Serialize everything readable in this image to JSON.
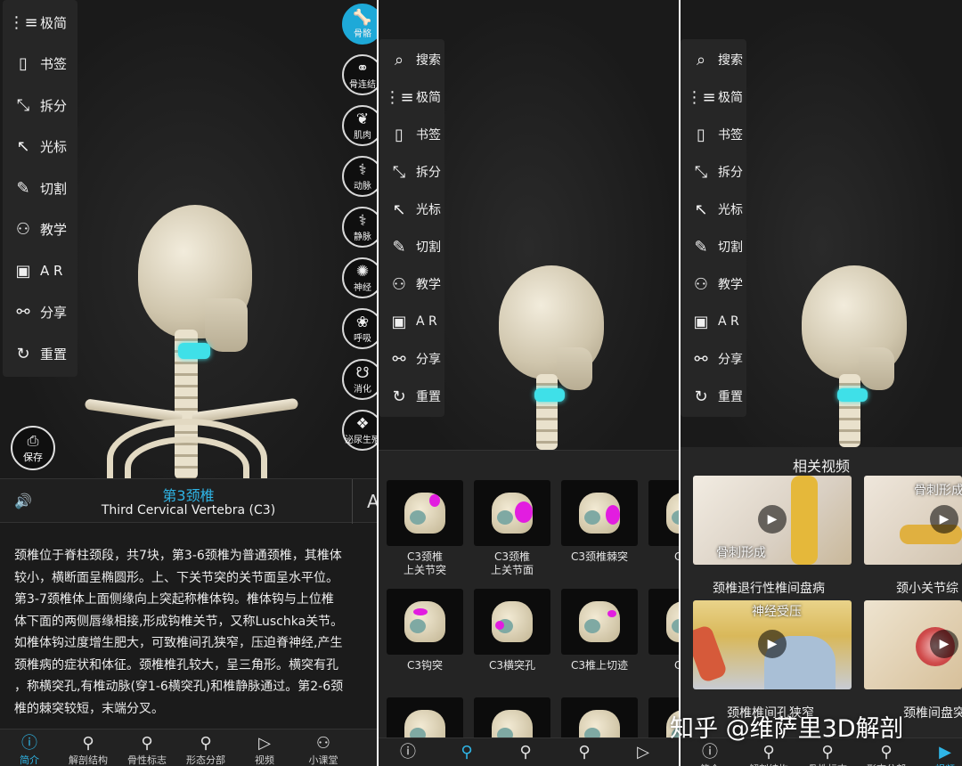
{
  "panel1": {
    "toolbar": [
      {
        "icon": "collapse-icon",
        "glyph": "⋮≡",
        "label": "极简"
      },
      {
        "icon": "bookmark-icon",
        "glyph": "▯",
        "label": "书签"
      },
      {
        "icon": "split-icon",
        "glyph": "⤡",
        "label": "拆分"
      },
      {
        "icon": "cursor-icon",
        "glyph": "↖",
        "label": "光标"
      },
      {
        "icon": "cut-icon",
        "glyph": "✎",
        "label": "切割"
      },
      {
        "icon": "teach-icon",
        "glyph": "⚇",
        "label": "教学"
      },
      {
        "icon": "ar-icon",
        "glyph": "▣",
        "label": "A R"
      },
      {
        "icon": "share-icon",
        "glyph": "⚯",
        "label": "分享"
      },
      {
        "icon": "reset-icon",
        "glyph": "↻",
        "label": "重置"
      }
    ],
    "systems": [
      {
        "icon": "bone-icon",
        "glyph": "🦴",
        "label": "骨骼",
        "active": true
      },
      {
        "icon": "joint-icon",
        "glyph": "⚭",
        "label": "骨连结",
        "active": false
      },
      {
        "icon": "muscle-icon",
        "glyph": "❦",
        "label": "肌肉",
        "active": false
      },
      {
        "icon": "artery-icon",
        "glyph": "⚕",
        "label": "动脉",
        "active": false
      },
      {
        "icon": "vein-icon",
        "glyph": "⚕",
        "label": "静脉",
        "active": false
      },
      {
        "icon": "nerve-icon",
        "glyph": "✺",
        "label": "神经",
        "active": false
      },
      {
        "icon": "lung-icon",
        "glyph": "❀",
        "label": "呼吸",
        "active": false
      },
      {
        "icon": "stomach-icon",
        "glyph": "☋",
        "label": "消化",
        "active": false
      },
      {
        "icon": "kidney-icon",
        "glyph": "❖",
        "label": "泌尿生殖",
        "active": false
      }
    ],
    "save_label": "保存",
    "title_cn": "第3颈椎",
    "title_en": "Third Cervical Vertebra (C3)",
    "font_button": "A",
    "description": "颈椎位于脊柱颈段，共7块，第3-6颈椎为普通颈椎，其椎体\n较小，横断面呈椭圆形。上、下关节突的关节面呈水平位。\n第3-7颈椎体上面侧缘向上突起称椎体钩。椎体钩与上位椎\n体下面的两侧唇缘相接,形成钩椎关节，又称Luschka关节。\n如椎体钩过度增生肥大，可致椎间孔狭窄，压迫脊神经,产生\n颈椎病的症状和体征。颈椎椎孔较大，呈三角形。横突有孔\n，称横突孔,有椎动脉(穿1-6横突孔)和椎静脉通过。第2-6颈\n椎的棘突较短，末端分叉。",
    "nav": [
      {
        "icon": "info-icon",
        "glyph": "ⓘ",
        "label": "简介",
        "active": true
      },
      {
        "icon": "anatomy-icon",
        "glyph": "⚲",
        "label": "解剖结构",
        "active": false
      },
      {
        "icon": "landmark-icon",
        "glyph": "⚲",
        "label": "骨性标志",
        "active": false
      },
      {
        "icon": "morph-icon",
        "glyph": "⚲",
        "label": "形态分部",
        "active": false
      },
      {
        "icon": "video-icon",
        "glyph": "▷",
        "label": "视频",
        "active": false
      },
      {
        "icon": "class-icon",
        "glyph": "⚇",
        "label": "小课堂",
        "active": false
      }
    ]
  },
  "panel2": {
    "toolbar": [
      {
        "icon": "search-icon",
        "glyph": "⌕",
        "label": "搜索"
      },
      {
        "icon": "collapse-icon",
        "glyph": "⋮≡",
        "label": "极简"
      },
      {
        "icon": "bookmark-icon",
        "glyph": "▯",
        "label": "书签"
      },
      {
        "icon": "split-icon",
        "glyph": "⤡",
        "label": "拆分"
      },
      {
        "icon": "cursor-icon",
        "glyph": "↖",
        "label": "光标"
      },
      {
        "icon": "cut-icon",
        "glyph": "✎",
        "label": "切割"
      },
      {
        "icon": "teach-icon",
        "glyph": "⚇",
        "label": "教学"
      },
      {
        "icon": "ar-icon",
        "glyph": "▣",
        "label": "A R"
      },
      {
        "icon": "share-icon",
        "glyph": "⚯",
        "label": "分享"
      },
      {
        "icon": "reset-icon",
        "glyph": "↻",
        "label": "重置"
      }
    ],
    "thumbnails": [
      {
        "label": "C3颈椎\n上关节突"
      },
      {
        "label": "C3颈椎\n上关节面"
      },
      {
        "label": "C3颈椎棘突"
      },
      {
        "label": "C3颈"
      },
      {
        "label": "C3钩突"
      },
      {
        "label": "C3横突孔"
      },
      {
        "label": "C3椎上切迹"
      },
      {
        "label": "C3椎"
      },
      {
        "label": ""
      },
      {
        "label": ""
      },
      {
        "label": ""
      },
      {
        "label": ""
      }
    ],
    "nav": [
      {
        "icon": "info-icon",
        "glyph": "ⓘ",
        "active": false
      },
      {
        "icon": "anatomy-icon",
        "glyph": "⚲",
        "active": true
      },
      {
        "icon": "landmark-icon",
        "glyph": "⚲",
        "active": false
      },
      {
        "icon": "morph-icon",
        "glyph": "⚲",
        "active": false
      },
      {
        "icon": "video-icon",
        "glyph": "▷",
        "active": false
      }
    ]
  },
  "panel3": {
    "toolbar": [
      {
        "icon": "search-icon",
        "glyph": "⌕",
        "label": "搜索"
      },
      {
        "icon": "collapse-icon",
        "glyph": "⋮≡",
        "label": "极简"
      },
      {
        "icon": "bookmark-icon",
        "glyph": "▯",
        "label": "书签"
      },
      {
        "icon": "split-icon",
        "glyph": "⤡",
        "label": "拆分"
      },
      {
        "icon": "cursor-icon",
        "glyph": "↖",
        "label": "光标"
      },
      {
        "icon": "cut-icon",
        "glyph": "✎",
        "label": "切割"
      },
      {
        "icon": "teach-icon",
        "glyph": "⚇",
        "label": "教学"
      },
      {
        "icon": "ar-icon",
        "glyph": "▣",
        "label": "A R"
      },
      {
        "icon": "share-icon",
        "glyph": "⚯",
        "label": "分享"
      },
      {
        "icon": "reset-icon",
        "glyph": "↻",
        "label": "重置"
      }
    ],
    "videos_title": "相关视频",
    "videos": [
      {
        "title": "颈椎退行性椎间盘病",
        "overlay": "骨刺形成"
      },
      {
        "title": "颈小关节综",
        "overlay": "骨刺形成"
      },
      {
        "title": "颈椎椎间孔狭窄",
        "overlay": "神经受压"
      },
      {
        "title": "颈椎间盘突",
        "overlay": ""
      }
    ],
    "nav": [
      {
        "icon": "info-icon",
        "glyph": "ⓘ",
        "label": "简介",
        "active": false
      },
      {
        "icon": "anatomy-icon",
        "glyph": "⚲",
        "label": "解剖结构",
        "active": false
      },
      {
        "icon": "landmark-icon",
        "glyph": "⚲",
        "label": "骨性标志",
        "active": false
      },
      {
        "icon": "morph-icon",
        "glyph": "⚲",
        "label": "形态分部",
        "active": false
      },
      {
        "icon": "video-icon",
        "glyph": "▶",
        "label": "视频",
        "active": true
      }
    ]
  },
  "watermark": "知乎 @维萨里3D解剖",
  "colors": {
    "accent": "#2fb5e6",
    "highlight": "#3fe0e8",
    "magenta": "#e21de0",
    "background": "#1b1b1b"
  }
}
